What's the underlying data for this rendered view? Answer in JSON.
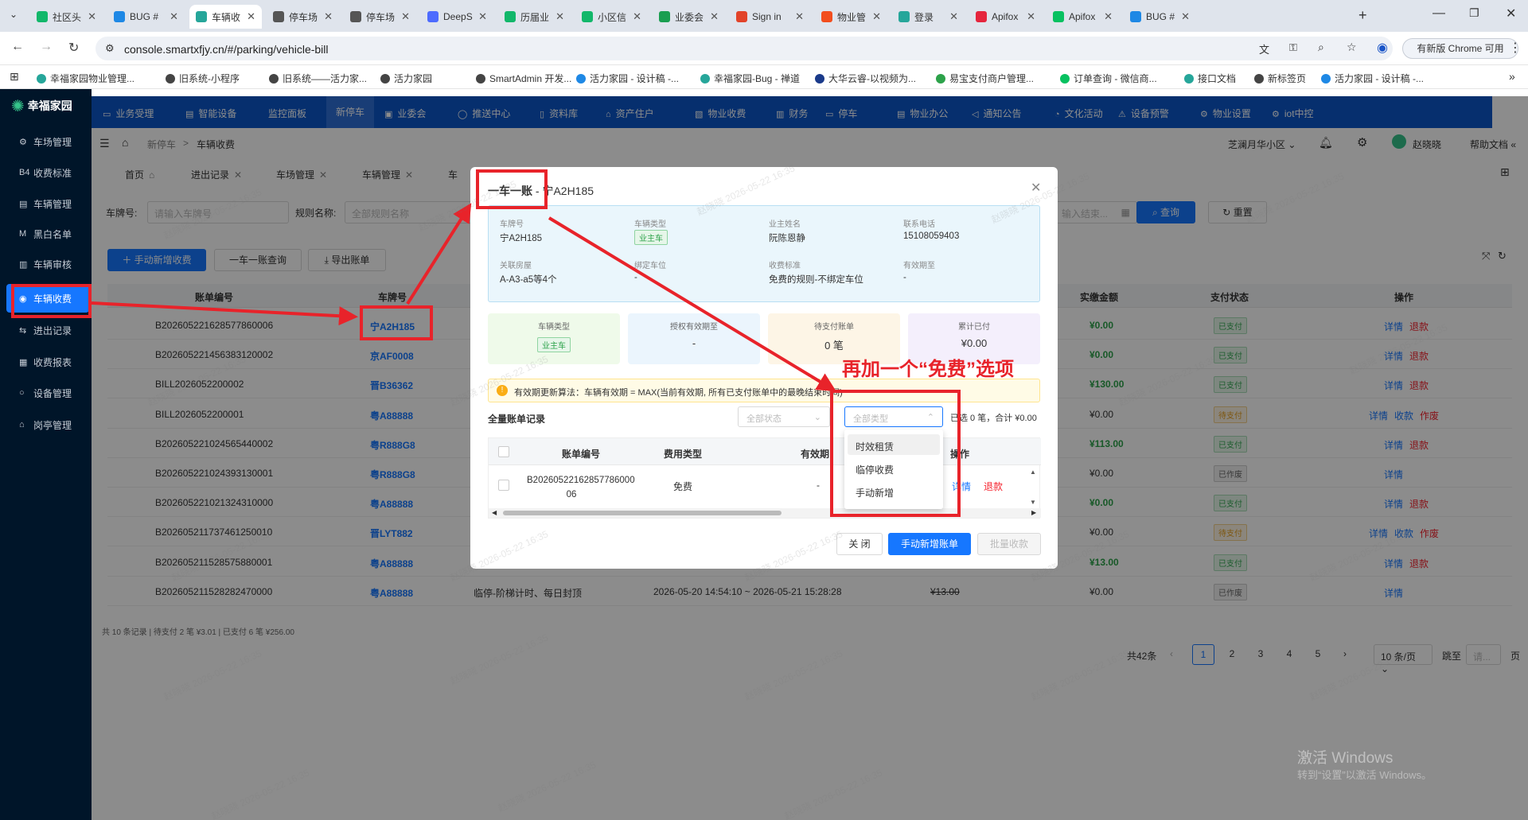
{
  "browser": {
    "tabs": [
      {
        "label": "社区头",
        "color": "#12b76a"
      },
      {
        "label": "BUG #",
        "color": "#1e88e5"
      },
      {
        "label": "车辆收",
        "color": "#26a69a"
      },
      {
        "label": "停车场",
        "color": "#555555"
      },
      {
        "label": "停车场",
        "color": "#555555"
      },
      {
        "label": "DeepS",
        "color": "#4d6bfe"
      },
      {
        "label": "历届业",
        "color": "#12b76a"
      },
      {
        "label": "小区信",
        "color": "#12b76a"
      },
      {
        "label": "业委会",
        "color": "#1a9e50"
      },
      {
        "label": "Sign in",
        "color": "#e24329"
      },
      {
        "label": "物业管",
        "color": "#f24e1e"
      },
      {
        "label": "登录",
        "color": "#26a69a"
      },
      {
        "label": "Apifox",
        "color": "#e5253d"
      },
      {
        "label": "Apifox",
        "color": "#07c160"
      },
      {
        "label": "BUG #",
        "color": "#1e88e5"
      }
    ],
    "url": "console.smartxfjy.cn/#/parking/vehicle-bill",
    "chrome_button": "有新版 Chrome 可用",
    "bookmarks": [
      {
        "label": "幸福家园物业管理...",
        "color": "#26a69a"
      },
      {
        "label": "旧系统-小程序",
        "color": "#444444"
      },
      {
        "label": "旧系统——活力家...",
        "color": "#444444"
      },
      {
        "label": "活力家园",
        "color": "#444444"
      },
      {
        "label": "SmartAdmin 开发...",
        "color": "#444444"
      },
      {
        "label": "活力家园 - 设计稿 -...",
        "color": "#1e88e5"
      },
      {
        "label": "幸福家园-Bug - 禅道",
        "color": "#26a69a"
      },
      {
        "label": "大华云睿-以视频为...",
        "color": "#1a3a8a"
      },
      {
        "label": "易宝支付商户管理...",
        "color": "#2ca24a"
      },
      {
        "label": "订单查询 - 微信商...",
        "color": "#07c160"
      },
      {
        "label": "接口文档",
        "color": "#26a69a"
      },
      {
        "label": "新标签页",
        "color": "#444444"
      },
      {
        "label": "活力家园 - 设计稿 -...",
        "color": "#1e88e5"
      }
    ]
  },
  "app": {
    "logo": "幸福家园",
    "sidebar": [
      {
        "icon": "⚙",
        "label": "车场管理"
      },
      {
        "icon": "B4",
        "label": "收费标准"
      },
      {
        "icon": "▤",
        "label": "车辆管理"
      },
      {
        "icon": "M",
        "label": "黑白名单"
      },
      {
        "icon": "▥",
        "label": "车辆审核"
      },
      {
        "icon": "◉",
        "label": "车辆收费"
      },
      {
        "icon": "⇆",
        "label": "进出记录"
      },
      {
        "icon": "▦",
        "label": "收费报表"
      },
      {
        "icon": "○",
        "label": "设备管理"
      },
      {
        "icon": "⌂",
        "label": "岗亭管理"
      }
    ],
    "topnav": [
      "业务受理",
      "智能设备",
      "监控面板",
      "新停车",
      "业委会",
      "推送中心",
      "资料库",
      "资产住户",
      "物业收费",
      "财务",
      "停车",
      "物业办公",
      "通知公告",
      "文化活动",
      "设备预警",
      "物业设置",
      "iot中控"
    ],
    "breadcrumb": {
      "parent": "新停车",
      "sep": ">",
      "current": "车辆收费"
    },
    "header_right": {
      "community": "芝澜月华小区",
      "user": "赵晓晓",
      "help": "帮助文档"
    },
    "tags": [
      "首页",
      "进出记录",
      "车场管理",
      "车辆管理",
      "车"
    ],
    "search": {
      "plate_label": "车牌号:",
      "plate_placeholder": "请输入车牌号",
      "rule_label": "规则名称:",
      "rule_placeholder": "全部规则名称",
      "date_placeholder": "输入结束...",
      "search_btn": "查询",
      "reset_btn": "重置"
    },
    "actions": {
      "add": "手动新增收费",
      "query": "一车一账查询",
      "export": "导出账单"
    },
    "table": {
      "headers": {
        "bill_no": "账单编号",
        "plate": "车牌号",
        "paid": "实缴金额",
        "status": "支付状态",
        "ops": "操作"
      },
      "rows": [
        {
          "bill": "B202605221628577860006",
          "plate": "宁A2H185",
          "type": "",
          "period": "",
          "amount": "",
          "paid": "¥0.00",
          "status": "已支付",
          "st": "paid",
          "ops": [
            "详情",
            "退款"
          ]
        },
        {
          "bill": "B202605221456383120002",
          "plate": "京AF0008",
          "type": "",
          "period": "",
          "amount": "",
          "paid": "¥0.00",
          "status": "已支付",
          "st": "paid",
          "ops": [
            "详情",
            "退款"
          ]
        },
        {
          "bill": "BILL2026052200002",
          "plate": "晋B36362",
          "type": "",
          "period": "",
          "amount": "",
          "paid": "¥130.00",
          "status": "已支付",
          "st": "paid",
          "ops": [
            "详情",
            "退款"
          ]
        },
        {
          "bill": "BILL2026052200001",
          "plate": "粤A88888",
          "type": "",
          "period": "",
          "amount": "",
          "paid": "¥0.00",
          "status": "待支付",
          "st": "pending",
          "ops": [
            "详情",
            "收款",
            "作废"
          ]
        },
        {
          "bill": "B202605221024565440002",
          "plate": "粤R888G8",
          "type": "",
          "period": "",
          "amount": "",
          "paid": "¥113.00",
          "status": "已支付",
          "st": "paid",
          "ops": [
            "详情",
            "退款"
          ]
        },
        {
          "bill": "B202605221024393130001",
          "plate": "粤R888G8",
          "type": "",
          "period": "",
          "amount": "",
          "paid": "¥0.00",
          "status": "已作废",
          "st": "void",
          "ops": [
            "详情"
          ]
        },
        {
          "bill": "B202605221021324310000",
          "plate": "粤A88888",
          "type": "",
          "period": "",
          "amount": "",
          "paid": "¥0.00",
          "status": "已支付",
          "st": "paid",
          "ops": [
            "详情",
            "退款"
          ]
        },
        {
          "bill": "B202605211737461250010",
          "plate": "晋LYT882",
          "type": "",
          "period": "",
          "amount": "",
          "paid": "¥0.00",
          "status": "待支付",
          "st": "pending",
          "ops": [
            "详情",
            "收款",
            "作废"
          ]
        },
        {
          "bill": "B202605211528575880001",
          "plate": "粤A88888",
          "type": "",
          "period": "",
          "amount": "",
          "paid": "¥13.00",
          "status": "已支付",
          "st": "paid",
          "ops": [
            "详情",
            "退款"
          ]
        },
        {
          "bill": "B202605211528282470000",
          "plate": "粤A88888",
          "type": "临停-阶梯计时、每日封顶",
          "period": "2026-05-20 14:54:10 ~ 2026-05-21 15:28:28",
          "amount": "¥13.00",
          "paid": "¥0.00",
          "status": "已作废",
          "st": "void",
          "ops": [
            "详情"
          ]
        }
      ],
      "summary": "共 10 条记录 | 待支付 2 笔 ¥3.01 | 已支付 6 笔 ¥256.00"
    },
    "pager": {
      "total": "共42条",
      "pages": [
        "1",
        "2",
        "3",
        "4",
        "5"
      ],
      "size": "10 条/页",
      "goto": "跳至",
      "goto_ph": "请...",
      "page_unit": "页"
    }
  },
  "modal": {
    "title_bold": "一车一账",
    "title_rest": " - 宁A2H185",
    "info": [
      {
        "label": "车牌号",
        "value": "宁A2H185"
      },
      {
        "label": "车辆类型",
        "value": "业主车"
      },
      {
        "label": "业主姓名",
        "value": "阮陈恩静"
      },
      {
        "label": "联系电话",
        "value": "15108059403"
      },
      {
        "label": "关联房屋",
        "value": "A-A3-a5等4个"
      },
      {
        "label": "绑定车位",
        "value": "-"
      },
      {
        "label": "收费标准",
        "value": "免费的规则-不绑定车位"
      },
      {
        "label": "有效期至",
        "value": "-"
      }
    ],
    "cards": [
      {
        "title": "车辆类型",
        "value": "业主车",
        "bg": "#effaea"
      },
      {
        "title": "授权有效期至",
        "value": "-",
        "bg": "#ebf5fd"
      },
      {
        "title": "待支付账单",
        "value": "0 笔",
        "bg": "#fdf5e6"
      },
      {
        "title": "累计已付",
        "value": "¥0.00",
        "bg": "#f4effc"
      }
    ],
    "notice": "有效期更新算法：车辆有效期 = MAX(当前有效期, 所有已支付账单中的最晚结束时间)",
    "records_title": "全量账单记录",
    "status_placeholder": "全部状态",
    "type_placeholder": "全部类型",
    "selected_summary": "已选 0 笔，合计 ¥0.00",
    "type_options": [
      "时效租赁",
      "临停收费",
      "手动新增"
    ],
    "inner_headers": {
      "bill": "账单编号",
      "fee": "费用类型",
      "valid": "有效期",
      "ops": "操作"
    },
    "inner_row": {
      "bill": "B20260522162857786000 06",
      "fee": "免费",
      "valid": "-",
      "ops": [
        "详情",
        "退款"
      ]
    },
    "buttons": {
      "close": "关 闭",
      "add": "手动新增账单",
      "batch": "批量收款"
    }
  },
  "annotation": {
    "text": "再加一个“免费”选项",
    "color": "#e8232a"
  },
  "watermark": {
    "text": "赵晓晓 2026-05-22 16:35"
  },
  "windows": {
    "activate": "激活 Windows",
    "hint": "转到“设置”以激活 Windows。"
  }
}
